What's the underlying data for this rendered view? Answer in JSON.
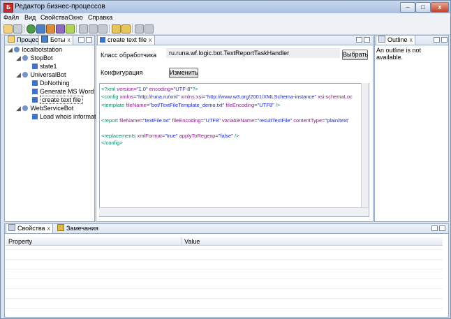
{
  "window": {
    "title": "Редактор бизнес-процессов",
    "app_icon_letter": "Б"
  },
  "window_controls": {
    "minimize": "–",
    "maximize": "□",
    "close": "x"
  },
  "menu": [
    "Файл",
    "Вид",
    "Свойства",
    "Окно",
    "Справка"
  ],
  "left_panel": {
    "tabs": [
      {
        "label": "Процес",
        "close": ""
      },
      {
        "label": "Боты",
        "close": "x"
      }
    ],
    "tree": [
      {
        "label": "localbotstation"
      },
      {
        "label": "StopBot"
      },
      {
        "label": "state1"
      },
      {
        "label": "UniversalBot"
      },
      {
        "label": "DoNothing"
      },
      {
        "label": "Generate MS Word Re"
      },
      {
        "label": "create text file"
      },
      {
        "label": "WebServiceBot"
      },
      {
        "label": "Load whois informati"
      }
    ]
  },
  "editor": {
    "tab": {
      "label": "create text file",
      "close": "x"
    },
    "handler_class_label": "Класс обработчика",
    "handler_class_value": "ru.runa.wf.logic.bot.TextReportTaskHandler",
    "select_button": "Выбрать",
    "configuration_label": "Конфигурация",
    "edit_button": "Изменить"
  },
  "xml_lines": [
    [
      [
        "tag",
        "<?xml "
      ],
      [
        "attr",
        "version="
      ],
      [
        "val",
        "\"1.0\""
      ],
      [
        "attr",
        " encoding="
      ],
      [
        "val",
        "\"UTF-8\""
      ],
      [
        "tag",
        "?>"
      ]
    ],
    [
      [
        "tag",
        "<config "
      ],
      [
        "attr",
        "xmlns="
      ],
      [
        "val",
        "\"http://runa.ru/xml\""
      ],
      [
        "attr",
        " xmlns:xsi="
      ],
      [
        "val",
        "\"http://www.w3.org/2001/XMLSchema-instance\""
      ],
      [
        "attr",
        " xsi:schemaLoc"
      ]
    ],
    [
      [
        "tag",
        "   <template "
      ],
      [
        "attr",
        "fileName="
      ],
      [
        "val",
        "\"bot/TextFileTemplate_demo.txt\""
      ],
      [
        "attr",
        " fileEncoding="
      ],
      [
        "val",
        "\"UTF8\""
      ],
      [
        "tag",
        " />"
      ]
    ],
    [],
    [
      [
        "tag",
        "   <report "
      ],
      [
        "attr",
        "fileName="
      ],
      [
        "val",
        "\"textFile.txt\""
      ],
      [
        "attr",
        " fileEncoding="
      ],
      [
        "val",
        "\"UTF8\""
      ],
      [
        "attr",
        " variableName="
      ],
      [
        "val",
        "\"resultTextFile\""
      ],
      [
        "attr",
        " contentType="
      ],
      [
        "val",
        "\"plain/text'"
      ]
    ],
    [],
    [
      [
        "tag",
        "   <replacements "
      ],
      [
        "attr",
        "xmlFormat="
      ],
      [
        "val",
        "\"true\""
      ],
      [
        "attr",
        " applyToRegexp="
      ],
      [
        "val",
        "\"false\""
      ],
      [
        "tag",
        " />"
      ]
    ],
    [
      [
        "tag",
        "</config>"
      ]
    ]
  ],
  "outline": {
    "tab": {
      "label": "Outline",
      "close": "x"
    },
    "message": "An outline is not available."
  },
  "bottom_panel": {
    "tabs": [
      {
        "label": "Свойства",
        "close": "x"
      },
      {
        "label": "Замечания",
        "close": ""
      }
    ],
    "columns": [
      "Property",
      "Value"
    ]
  }
}
